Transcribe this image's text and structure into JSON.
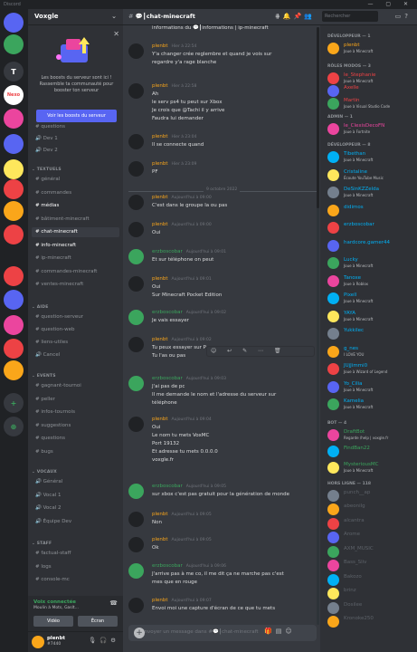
{
  "app": {
    "title": "Discord"
  },
  "server": {
    "name": "Voxgle"
  },
  "boost": {
    "text": "Les boosts du serveur sont ici ! Rassemble ta communauté pour booster ton serveur",
    "button": "Voir les boosts du serveur"
  },
  "channel_header": {
    "name": "💬┃chat-minecraft",
    "topic": "↑ #informations | ip-minecraft"
  },
  "search": {
    "placeholder": "Rechercher"
  },
  "guilds": [
    {
      "name": "discord-home",
      "label": "",
      "color": "#5865f2"
    },
    {
      "name": "server-green",
      "label": "",
      "color": "#3ba55d"
    },
    {
      "name": "server-t",
      "label": "T",
      "color": "#36393f"
    },
    {
      "name": "server-nexo",
      "label": "Nexo",
      "color": "#ffffff"
    },
    {
      "name": "server-4",
      "label": "",
      "color": "#eb459e"
    },
    {
      "name": "server-5",
      "label": "",
      "color": "#5865f2"
    },
    {
      "name": "server-6",
      "label": "",
      "color": "#fee75c"
    },
    {
      "name": "server-7",
      "label": "",
      "color": "#ed4245"
    },
    {
      "name": "server-8",
      "label": "",
      "color": "#faa61a"
    },
    {
      "name": "server-9",
      "label": "",
      "color": "#ed4245"
    },
    {
      "name": "server-10",
      "label": "",
      "color": "#202225"
    },
    {
      "name": "server-11",
      "label": "",
      "color": "#ed4245"
    },
    {
      "name": "server-12",
      "label": "",
      "color": "#5865f2"
    },
    {
      "name": "server-13",
      "label": "",
      "color": "#eb459e"
    },
    {
      "name": "server-14",
      "label": "",
      "color": "#ed4245"
    },
    {
      "name": "server-15",
      "label": "",
      "color": "#faa61a"
    },
    {
      "name": "add-server",
      "label": "+",
      "color": "#36393f"
    },
    {
      "name": "explore",
      "label": "⊕",
      "color": "#36393f"
    }
  ],
  "channels": {
    "top": [
      "questions",
      "Dev 1",
      "Dev 2"
    ],
    "cat_textuels": "TEXTUELS",
    "textuels": [
      "général",
      "commandes",
      "médias",
      "bâtiment-minecraft",
      "chat-minecraft",
      "info-minecraft",
      "ip-minecraft",
      "commandes-minecraft",
      "ventes-minecraft"
    ],
    "cat_aide": "AIDE",
    "aide": [
      "question-serveur",
      "question-web",
      "liens-utiles",
      "Cancel"
    ],
    "cat_events": "EVENTS",
    "events": [
      "gagnant-tournoi",
      "peller",
      "infos-tournois",
      "suggestions",
      "questions",
      "bugs"
    ],
    "cat_vocaux": "VOCAUX",
    "vocaux": [
      "Général",
      "Vocal 1",
      "Vocal 2",
      "Équipe Dev"
    ],
    "cat_staff": "STAFF",
    "staff": [
      "factual-staff",
      "logs",
      "console-mc"
    ]
  },
  "voice": {
    "status": "Voix connectée",
    "detail": "Moulin à Mots, Gaslt...",
    "video": "Vidéo",
    "screen": "Écran"
  },
  "user": {
    "name": "plenbt",
    "tag": "#7440"
  },
  "messages": [
    {
      "author": "",
      "time": "",
      "lines": [
        "informations du 💬┃informations | ip-minecraft"
      ]
    },
    {
      "author": "plenbt",
      "time": "Hier à 22:54",
      "lines": [
        "Y'a changer crée reglembre et quand je vois sur",
        "regardre y'a rage blanche"
      ]
    },
    {
      "author": "plenbt",
      "time": "Hier à 22:58",
      "lines": [
        "Ah",
        "le serv ps4 tu peut sur Xbox",
        "Je crois que @Tachi il y arrive",
        "Faudra lui demander"
      ]
    },
    {
      "author": "plenbt",
      "time": "Hier à 23:04",
      "lines": [
        "Il se connecte quand"
      ]
    },
    {
      "author": "plenbt",
      "time": "Hier à 23:09",
      "lines": [
        "PF"
      ]
    },
    {
      "author": "plenbt",
      "time": "Aujourd'hui à 09:00",
      "lines": [
        "C'est dans le groupe la ou pas"
      ]
    },
    {
      "author": "plenbt",
      "time": "Aujourd'hui à 09:00",
      "lines": [
        "Oui"
      ]
    },
    {
      "author": "erzboscobar",
      "time": "Aujourd'hui à 09:01",
      "lines": [
        "Et sur téléphone on peut"
      ]
    },
    {
      "author": "plenbt",
      "time": "Aujourd'hui à 09:01",
      "lines": [
        "Oui",
        "Sur Minecraft Pocket Edition"
      ]
    },
    {
      "author": "erzboscobar",
      "time": "Aujourd'hui à 09:02",
      "lines": [
        "Je vais essayer"
      ]
    },
    {
      "author": "plenbt",
      "time": "Aujourd'hui à 09:02",
      "lines": [
        "Tu peux essayer sur P",
        "Tu l'as ou pas"
      ]
    },
    {
      "author": "erzboscobar",
      "time": "Aujourd'hui à 09:03",
      "lines": [
        "J'ai pas de pc",
        "Il me demande le nom et l'adresse du serveur sur",
        "téléphone"
      ]
    },
    {
      "author": "plenbt",
      "time": "Aujourd'hui à 09:04",
      "lines": [
        "Oui",
        "Le nom tu mets VoxMC",
        "Port 19132",
        "Et adresse tu mets 0.0.0.0",
        "voxgle.fr"
      ]
    },
    {
      "author": "erzboscobar",
      "time": "Aujourd'hui à 09:05",
      "lines": [
        "sur xbox c'est pas gratuit pour la génération de monde"
      ]
    },
    {
      "author": "plenbt",
      "time": "Aujourd'hui à 09:05",
      "lines": [
        "Non"
      ]
    },
    {
      "author": "plenbt",
      "time": "Aujourd'hui à 09:05",
      "lines": [
        "Ok"
      ]
    },
    {
      "author": "erzboscobar",
      "time": "Aujourd'hui à 09:06",
      "lines": [
        "J'arrive pas à me co, il me dit ça ne marche pas c'est",
        "mes que en rouge"
      ]
    },
    {
      "author": "plenbt",
      "time": "Aujourd'hui à 09:07",
      "lines": [
        "Envoi moi une capture d'écran de ce que tu mets"
      ]
    }
  ],
  "date_divider": "9 octobre 2022",
  "composer": {
    "placeholder": "Envoyer un message dans #💬┃chat-minecraft"
  },
  "members": {
    "cat_dev": "DÉVELOPPEUR — 1",
    "dev": [
      {
        "name": "plenbt",
        "status": "Joue à Minecraft",
        "color": "#faa61a"
      }
    ],
    "cat_roles": "RÔLES MODOS — 3",
    "roles": [
      {
        "name": "le_Stephanie",
        "status": "Joue à Minecraft",
        "color": "#ed4245"
      },
      {
        "name": "Axelle",
        "status": "",
        "color": "#ed4245"
      },
      {
        "name": "Martin",
        "status": "Joue à Visual Studio Code",
        "color": "#ed4245"
      }
    ],
    "cat_admin": "ADMIN — 1",
    "admin": [
      {
        "name": "le_ClexisDecoFN",
        "status": "Joue à Fortnite",
        "color": "#eb459e"
      }
    ],
    "cat_dev2": "DÉVELOPPEUR — 8",
    "dev2": [
      {
        "name": "Tibethan",
        "status": "Joue à Minecraft",
        "color": "#00b0f4"
      },
      {
        "name": "Cristaline",
        "status": "Écoute YouTube Music",
        "color": "#00b0f4"
      },
      {
        "name": "DeSinKZZelda",
        "status": "Joue à Minecraft",
        "color": "#00b0f4"
      },
      {
        "name": "didimos",
        "status": "",
        "color": "#00b0f4"
      },
      {
        "name": "erzboscobar",
        "status": "",
        "color": "#00b0f4"
      },
      {
        "name": "hardcore.gamer44",
        "status": "",
        "color": "#00b0f4"
      },
      {
        "name": "Lucky",
        "status": "Joue à Minecraft",
        "color": "#00b0f4"
      },
      {
        "name": "Tanoxe",
        "status": "Joue à Roblox",
        "color": "#00b0f4"
      },
      {
        "name": "Pixell",
        "status": "Joue à Minecraft",
        "color": "#00b0f4"
      },
      {
        "name": "YAYA",
        "status": "Joue à Minecraft",
        "color": "#00b0f4"
      },
      {
        "name": "Yukkilec",
        "status": "",
        "color": "#00b0f4"
      },
      {
        "name": "g_nes",
        "status": "I LOVE YOU",
        "color": "#00b0f4"
      },
      {
        "name": "JUjJimmi0",
        "status": "Joue à Wizard of Legend",
        "color": "#00b0f4"
      },
      {
        "name": "Yo_Cilia",
        "status": "Joue à Minecraft",
        "color": "#00b0f4"
      },
      {
        "name": "Kamelia",
        "status": "Joue à Minecraft",
        "color": "#00b0f4"
      }
    ],
    "cat_bot": "BOT — 4",
    "bot": [
      {
        "name": "DraftBot",
        "status": "Regarde /help | voxgle.fr",
        "color": "#3ba55d"
      },
      {
        "name": "FindBan22",
        "status": "",
        "color": "#3ba55d"
      },
      {
        "name": "MysteriousMC",
        "status": "Joue à Minecraft",
        "color": "#3ba55d"
      }
    ],
    "cat_offline": "HORS LIGNE — 118",
    "offline": [
      "punch__ap",
      "abeonilg",
      "alcantra",
      "Arome",
      "AXM_MUSIC",
      "Bass_Sliv",
      "Bakozo",
      "brinz",
      "Dosilee",
      "Kronoke250"
    ]
  }
}
